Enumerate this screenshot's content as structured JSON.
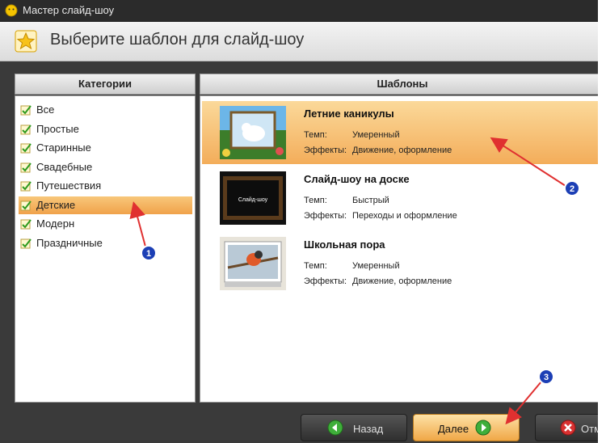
{
  "window": {
    "title": "Мастер слайд-шоу"
  },
  "header": {
    "title": "Выберите шаблон для слайд-шоу"
  },
  "categories": {
    "header": "Категории",
    "items": [
      {
        "label": "Все"
      },
      {
        "label": "Простые"
      },
      {
        "label": "Старинные"
      },
      {
        "label": "Свадебные"
      },
      {
        "label": "Путешествия"
      },
      {
        "label": "Детские"
      },
      {
        "label": "Модерн"
      },
      {
        "label": "Праздничные"
      }
    ],
    "selected_index": 5
  },
  "templates": {
    "header": "Шаблоны",
    "tempo_label": "Темп:",
    "effects_label": "Эффекты:",
    "items": [
      {
        "title": "Летние каникулы",
        "tempo": "Умеренный",
        "effects": "Движение, оформление",
        "thumb_text": ""
      },
      {
        "title": "Слайд-шоу на доске",
        "tempo": "Быстрый",
        "effects": "Переходы и оформление",
        "thumb_text": "Слайд-шоу"
      },
      {
        "title": "Школьная пора",
        "tempo": "Умеренный",
        "effects": "Движение, оформление",
        "thumb_text": ""
      }
    ],
    "selected_index": 0
  },
  "footer": {
    "back_label": "Назад",
    "next_label": "Далее",
    "cancel_label": "Отм"
  },
  "annotations": {
    "badge1": "1",
    "badge2": "2",
    "badge3": "3"
  },
  "colors": {
    "selection": "#f3ad5a",
    "arrow": "#e03030",
    "badge": "#1c3fb5"
  }
}
